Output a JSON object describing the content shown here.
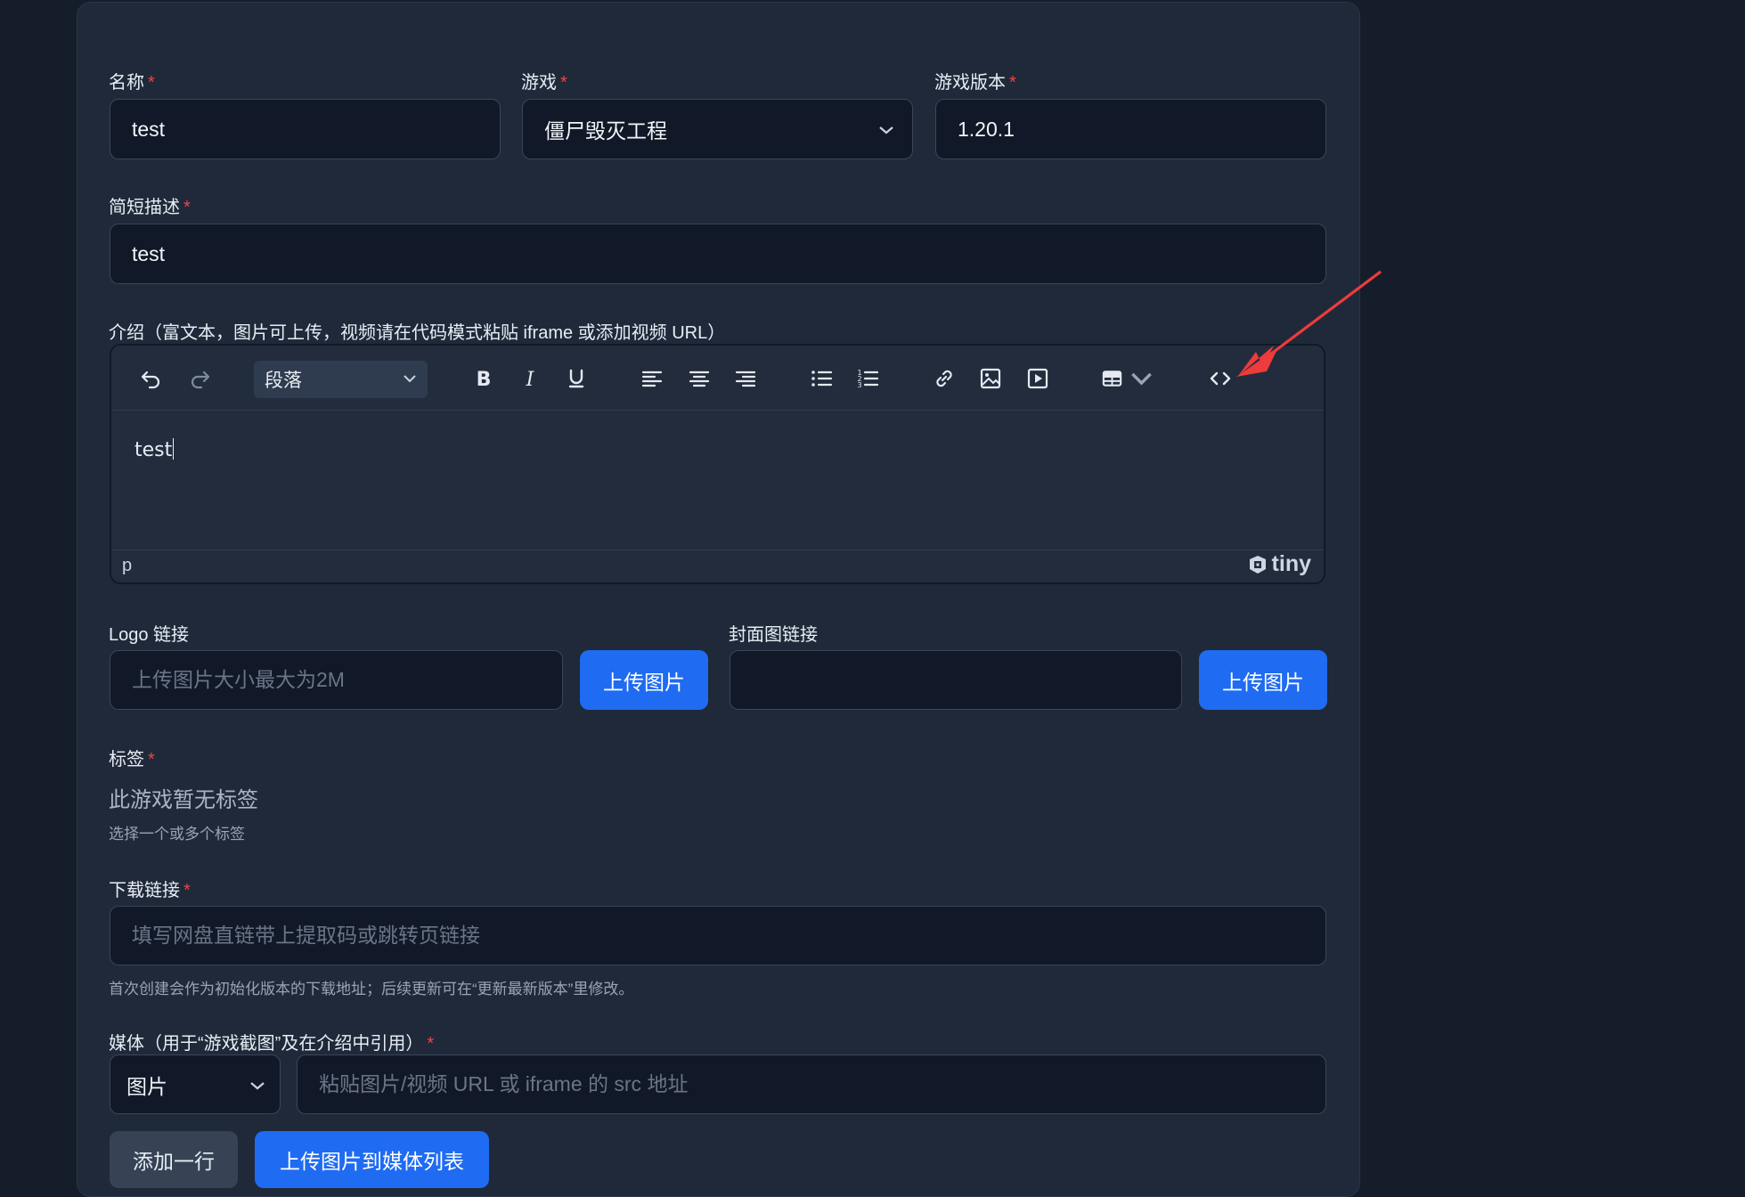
{
  "form": {
    "name": {
      "label": "名称",
      "value": "test"
    },
    "game": {
      "label": "游戏",
      "value": "僵尸毁灭工程"
    },
    "game_version": {
      "label": "游戏版本",
      "value": "1.20.1"
    },
    "short_desc": {
      "label": "简短描述",
      "value": "test"
    },
    "intro": {
      "label": "介绍（富文本，图片可上传，视频请在代码模式粘贴 iframe 或添加视频 URL）",
      "block_format": "段落",
      "content": "test",
      "status_path": "p",
      "brand": "tiny"
    },
    "logo": {
      "label": "Logo 链接",
      "placeholder": "上传图片大小最大为2M",
      "upload_label": "上传图片"
    },
    "cover": {
      "label": "封面图链接",
      "placeholder": "",
      "upload_label": "上传图片"
    },
    "tags": {
      "label": "标签",
      "empty_text": "此游戏暂无标签",
      "help": "选择一个或多个标签"
    },
    "download": {
      "label": "下载链接",
      "placeholder": "填写网盘直链带上提取码或跳转页链接",
      "help": "首次创建会作为初始化版本的下载地址；后续更新可在“更新最新版本”里修改。"
    },
    "media": {
      "label": "媒体（用于“游戏截图”及在介绍中引用）",
      "type_value": "图片",
      "placeholder": "粘贴图片/视频 URL 或 iframe 的 src 地址",
      "add_row_label": "添加一行",
      "upload_label": "上传图片到媒体列表"
    },
    "required_mark": "*"
  },
  "colors": {
    "background": "#161d2a",
    "card": "#1f2939",
    "input": "#111827",
    "primary": "#1f6bf2",
    "required": "#ef4444",
    "annotation_arrow": "#ee3b3b"
  },
  "icons": [
    "undo-icon",
    "redo-icon",
    "bold-icon",
    "italic-icon",
    "underline-icon",
    "align-left-icon",
    "align-center-icon",
    "align-right-icon",
    "bullet-list-icon",
    "numbered-list-icon",
    "link-icon",
    "image-icon",
    "media-icon",
    "table-icon",
    "source-code-icon"
  ]
}
